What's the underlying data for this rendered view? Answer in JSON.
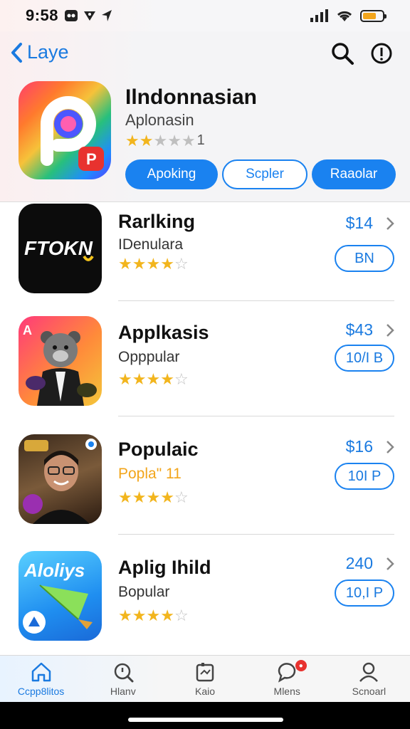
{
  "status": {
    "time": "9:58"
  },
  "nav": {
    "back_label": "Laye"
  },
  "hero": {
    "title": "Ilndonnasian",
    "subtitle": "Aplonasin",
    "rating_count": "1",
    "stars_on": 2,
    "pills": [
      "Apoking",
      "Scpler",
      "Raaolar"
    ]
  },
  "apps": [
    {
      "name": "Rarlking",
      "category": "IDenulara",
      "price": "$14",
      "get": "BN",
      "stars_on": 4,
      "icon_text": "FTOKN"
    },
    {
      "name": "Applkasis",
      "category": "Opppular",
      "price": "$43",
      "get": "10/I B",
      "stars_on": 3.5,
      "icon_text": "A"
    },
    {
      "name": "Populaic",
      "category": "Popla\" 11",
      "price": "$16",
      "get": "10I P",
      "stars_on": 3.5,
      "icon_text": ""
    },
    {
      "name": "Aplig Ihild",
      "category": "Bopular",
      "price": "240",
      "get": "10,I P",
      "stars_on": 4,
      "icon_text": "Aloliys"
    }
  ],
  "tabs": [
    {
      "label": "Ccpp8litos",
      "icon": "home-icon"
    },
    {
      "label": "Hlanv",
      "icon": "search-icon"
    },
    {
      "label": "Kaio",
      "icon": "games-icon"
    },
    {
      "label": "Mlens",
      "icon": "chat-icon"
    },
    {
      "label": "Scnoarl",
      "icon": "profile-icon"
    }
  ],
  "colors": {
    "accent": "#1a82f0",
    "star": "#f2b51d"
  }
}
